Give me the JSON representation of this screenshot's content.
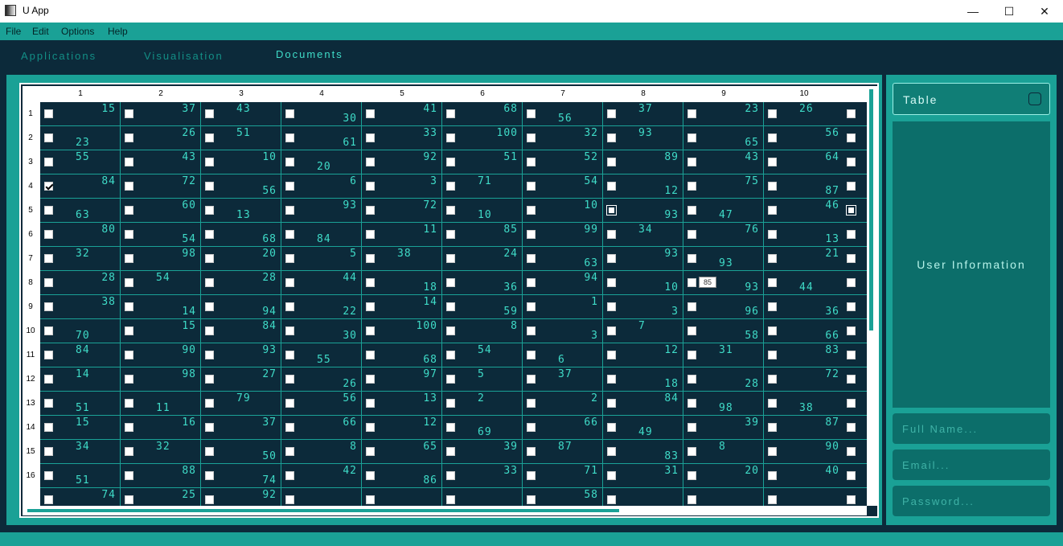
{
  "window": {
    "title": "U App",
    "minimize": "—",
    "maximize": "☐",
    "close": "✕"
  },
  "menu": [
    "File",
    "Edit",
    "Options",
    "Help"
  ],
  "tabs": [
    {
      "label": "Applications",
      "active": false
    },
    {
      "label": "Visualisation",
      "active": false
    },
    {
      "label": "Documents",
      "active": true
    }
  ],
  "table": {
    "columns": [
      "1",
      "2",
      "3",
      "4",
      "5",
      "6",
      "7",
      "8",
      "9",
      "10"
    ],
    "rows": [
      {
        "label": "1",
        "cells": [
          [
            15,
            "h"
          ],
          [
            37,
            "h"
          ],
          [
            43,
            "hl"
          ],
          [
            30,
            "l"
          ],
          [
            41,
            "h"
          ],
          [
            68,
            "h"
          ],
          [
            56,
            "ll"
          ],
          [
            37,
            "hl"
          ],
          [
            23,
            "h"
          ],
          [
            26,
            "hl"
          ]
        ],
        "checked": []
      },
      {
        "label": "2",
        "cells": [
          [
            23,
            "ll"
          ],
          [
            26,
            "h"
          ],
          [
            51,
            "hl"
          ],
          [
            61,
            "l"
          ],
          [
            33,
            "h"
          ],
          [
            100,
            "h"
          ],
          [
            32,
            "h"
          ],
          [
            93,
            "hl"
          ],
          [
            65,
            "l"
          ],
          [
            56,
            "h"
          ]
        ],
        "checked": []
      },
      {
        "label": "3",
        "cells": [
          [
            55,
            "hl"
          ],
          [
            43,
            "h"
          ],
          [
            10,
            "h"
          ],
          [
            20,
            "ll"
          ],
          [
            92,
            "h"
          ],
          [
            51,
            "h"
          ],
          [
            52,
            "h"
          ],
          [
            89,
            "h"
          ],
          [
            43,
            "h"
          ],
          [
            64,
            "h"
          ]
        ],
        "checked": []
      },
      {
        "label": "4",
        "cells": [
          [
            84,
            "h"
          ],
          [
            72,
            "h"
          ],
          [
            56,
            "l"
          ],
          [
            6,
            "h"
          ],
          [
            3,
            "h"
          ],
          [
            71,
            "hl"
          ],
          [
            54,
            "h"
          ],
          [
            12,
            "l"
          ],
          [
            75,
            "h"
          ],
          [
            87,
            "l"
          ]
        ],
        "checked": [
          0
        ]
      },
      {
        "label": "5",
        "cells": [
          [
            63,
            "ll"
          ],
          [
            60,
            "h"
          ],
          [
            13,
            "ll"
          ],
          [
            93,
            "h"
          ],
          [
            72,
            "h"
          ],
          [
            10,
            "ll"
          ],
          [
            10,
            "h"
          ],
          [
            93,
            "l"
          ],
          [
            47,
            "ll"
          ],
          [
            46,
            "h"
          ]
        ],
        "checked": []
      },
      {
        "label": "6",
        "cells": [
          [
            80,
            "h"
          ],
          [
            54,
            "l"
          ],
          [
            68,
            "l"
          ],
          [
            84,
            "ll"
          ],
          [
            11,
            "h"
          ],
          [
            85,
            "h"
          ],
          [
            99,
            "h"
          ],
          [
            34,
            "hl"
          ],
          [
            76,
            "h"
          ],
          [
            13,
            "l"
          ]
        ],
        "checked": []
      },
      {
        "label": "7",
        "cells": [
          [
            32,
            "hl"
          ],
          [
            98,
            "h"
          ],
          [
            20,
            "h"
          ],
          [
            5,
            "h"
          ],
          [
            38,
            "hl"
          ],
          [
            24,
            "h"
          ],
          [
            63,
            "l"
          ],
          [
            93,
            "h"
          ],
          [
            93,
            "ll"
          ],
          [
            21,
            "h"
          ]
        ],
        "checked": []
      },
      {
        "label": "8",
        "cells": [
          [
            28,
            "h"
          ],
          [
            54,
            "hl"
          ],
          [
            28,
            "h"
          ],
          [
            44,
            "h"
          ],
          [
            18,
            "l"
          ],
          [
            36,
            "l"
          ],
          [
            94,
            "h"
          ],
          [
            10,
            "l"
          ],
          [
            93,
            "l"
          ],
          [
            44,
            "ll"
          ]
        ],
        "checked": []
      },
      {
        "label": "9",
        "cells": [
          [
            38,
            "h"
          ],
          [
            14,
            "l"
          ],
          [
            94,
            "l"
          ],
          [
            22,
            "l"
          ],
          [
            14,
            "h"
          ],
          [
            59,
            "l"
          ],
          [
            1,
            "h"
          ],
          [
            3,
            "l"
          ],
          [
            96,
            "l"
          ],
          [
            36,
            "l"
          ]
        ],
        "checked": []
      },
      {
        "label": "10",
        "cells": [
          [
            70,
            "ll"
          ],
          [
            15,
            "h"
          ],
          [
            84,
            "h"
          ],
          [
            30,
            "l"
          ],
          [
            100,
            "h"
          ],
          [
            8,
            "h"
          ],
          [
            3,
            "l"
          ],
          [
            7,
            "hl"
          ],
          [
            58,
            "l"
          ],
          [
            66,
            "l"
          ]
        ],
        "checked": []
      },
      {
        "label": "11",
        "cells": [
          [
            84,
            "hl"
          ],
          [
            90,
            "h"
          ],
          [
            93,
            "h"
          ],
          [
            55,
            "ll"
          ],
          [
            68,
            "l"
          ],
          [
            54,
            "hl"
          ],
          [
            6,
            "ll"
          ],
          [
            12,
            "h"
          ],
          [
            31,
            "hl"
          ],
          [
            83,
            "h"
          ]
        ],
        "checked": []
      },
      {
        "label": "12",
        "cells": [
          [
            14,
            "hl"
          ],
          [
            98,
            "h"
          ],
          [
            27,
            "h"
          ],
          [
            26,
            "l"
          ],
          [
            97,
            "h"
          ],
          [
            5,
            "hl"
          ],
          [
            37,
            "hl"
          ],
          [
            18,
            "l"
          ],
          [
            28,
            "l"
          ],
          [
            72,
            "h"
          ]
        ],
        "checked": []
      },
      {
        "label": "13",
        "cells": [
          [
            51,
            "ll"
          ],
          [
            11,
            "ll"
          ],
          [
            79,
            "hl"
          ],
          [
            56,
            "h"
          ],
          [
            13,
            "h"
          ],
          [
            2,
            "hl"
          ],
          [
            2,
            "h"
          ],
          [
            84,
            "h"
          ],
          [
            98,
            "ll"
          ],
          [
            38,
            "ll"
          ]
        ],
        "checked": []
      },
      {
        "label": "14",
        "cells": [
          [
            15,
            "hl"
          ],
          [
            16,
            "h"
          ],
          [
            37,
            "h"
          ],
          [
            66,
            "h"
          ],
          [
            12,
            "h"
          ],
          [
            69,
            "ll"
          ],
          [
            66,
            "h"
          ],
          [
            49,
            "ll"
          ],
          [
            39,
            "h"
          ],
          [
            87,
            "h"
          ]
        ],
        "checked": []
      },
      {
        "label": "15",
        "cells": [
          [
            34,
            "hl"
          ],
          [
            32,
            "hl"
          ],
          [
            50,
            "l"
          ],
          [
            8,
            "h"
          ],
          [
            65,
            "h"
          ],
          [
            39,
            "h"
          ],
          [
            87,
            "hl"
          ],
          [
            83,
            "l"
          ],
          [
            8,
            "hl"
          ],
          [
            90,
            "h"
          ]
        ],
        "checked": []
      },
      {
        "label": "16",
        "cells": [
          [
            51,
            "ll"
          ],
          [
            88,
            "h"
          ],
          [
            74,
            "l"
          ],
          [
            42,
            "h"
          ],
          [
            86,
            "l"
          ],
          [
            33,
            "h"
          ],
          [
            71,
            "h"
          ],
          [
            31,
            "h"
          ],
          [
            20,
            "h"
          ],
          [
            40,
            "h"
          ]
        ],
        "checked": []
      },
      {
        "label": "",
        "cells": [
          [
            74,
            "h"
          ],
          [
            25,
            "h"
          ],
          [
            92,
            "h"
          ],
          [
            "",
            "h"
          ],
          [
            "",
            "h"
          ],
          [
            "",
            "h"
          ],
          [
            58,
            "h"
          ],
          [
            "",
            "h"
          ],
          [
            "",
            "h"
          ],
          [
            "",
            "h"
          ]
        ],
        "checked": []
      }
    ],
    "tooltip": "85"
  },
  "sidebar": {
    "table_button": "Table",
    "user_info_title": "User Information",
    "full_name_placeholder": "Full Name...",
    "email_placeholder": "Email...",
    "password_placeholder": "Password..."
  },
  "colors": {
    "accent": "#1aa196",
    "dark": "#0c2a3a",
    "text": "#3fdcc8"
  }
}
